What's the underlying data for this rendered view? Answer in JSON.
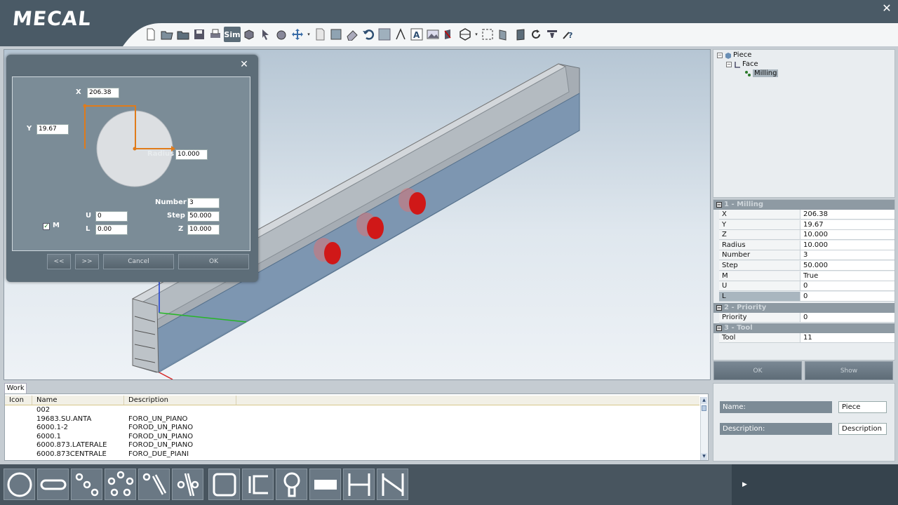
{
  "app": {
    "logo": "MECAL",
    "close_symbol": "✕"
  },
  "toolbar": {
    "buttons": [
      "new-file-icon",
      "open-folder-icon",
      "open-project-icon",
      "save-icon",
      "print-icon",
      "sim-button",
      "3d-view-icon",
      "pointer-icon",
      "pan-hand-icon",
      "move-icon",
      "blank-page-icon",
      "shade-icon",
      "eraser-icon",
      "undo-icon",
      "render-icon",
      "measure-icon",
      "text-icon",
      "image-icon",
      "face-select-icon",
      "cube-icon",
      "zoom-fit-icon",
      "front-view-icon",
      "side-view-icon",
      "rotate-icon",
      "settings-icon",
      "help-icon"
    ],
    "sim_label": "Sim"
  },
  "dialog": {
    "close_symbol": "✕",
    "x_label": "X",
    "x_value": "206.38",
    "y_label": "Y",
    "y_value": "19.67",
    "radius_label": "Radius",
    "radius_value": "10.000",
    "m_label": "M",
    "m_checked": true,
    "number_label": "Number",
    "number_value": "3",
    "u_label": "U",
    "u_value": "0",
    "step_label": "Step",
    "step_value": "50.000",
    "l_label": "L",
    "l_value": "0.00",
    "z_label": "Z",
    "z_value": "10.000",
    "prev_label": "<<",
    "next_label": ">>",
    "cancel_label": "Cancel",
    "ok_label": "OK"
  },
  "tree": {
    "root": "Piece",
    "child": "Face",
    "leaf": "Milling"
  },
  "properties": {
    "cat1": "1 - Milling",
    "cat2": "2 - Priority",
    "cat3": "3 - Tool",
    "rows1": [
      {
        "k": "X",
        "v": "206.38"
      },
      {
        "k": "Y",
        "v": "19.67"
      },
      {
        "k": "Z",
        "v": "10.000"
      },
      {
        "k": "Radius",
        "v": "10.000"
      },
      {
        "k": "Number",
        "v": "3"
      },
      {
        "k": "Step",
        "v": "50.000"
      },
      {
        "k": "M",
        "v": "True"
      },
      {
        "k": "U",
        "v": "0"
      },
      {
        "k": "L",
        "v": "0"
      }
    ],
    "priority": {
      "k": "Priority",
      "v": "0"
    },
    "tool": {
      "k": "Tool",
      "v": "11"
    },
    "ok_label": "OK",
    "show_label": "Show"
  },
  "work": {
    "tab": "Work",
    "headers": [
      "Icon",
      "Name",
      "Description"
    ],
    "rows": [
      {
        "name": "002",
        "desc": ""
      },
      {
        "name": "19683.SU.ANTA",
        "desc": "FORO_UN_PIANO"
      },
      {
        "name": "6000.1-2",
        "desc": "FOROD_UN_PIANO"
      },
      {
        "name": "6000.1",
        "desc": "FOROD_UN_PIANO"
      },
      {
        "name": "6000.873.LATERALE",
        "desc": "FOROD_UN_PIANO"
      },
      {
        "name": "6000.873CENTRALE",
        "desc": "FORO_DUE_PIANI"
      }
    ]
  },
  "detail": {
    "name_label": "Name:",
    "name_value": "Piece",
    "desc_label": "Description:",
    "desc_value": "Description"
  },
  "shapes": [
    "circle-shape-icon",
    "slot-shape-icon",
    "linear-holes-icon",
    "circular-holes-icon",
    "drill-pattern-icon",
    "multi-drill-icon",
    "rectangle-shape-icon",
    "notch-shape-icon",
    "keyhole-shape-icon",
    "filled-rectangle-icon",
    "h-profile-icon",
    "z-profile-icon"
  ],
  "next_symbol": "▶",
  "colors": {
    "accent": "#e07b1a",
    "hole": "#d01818",
    "header": "#4a5a66"
  }
}
